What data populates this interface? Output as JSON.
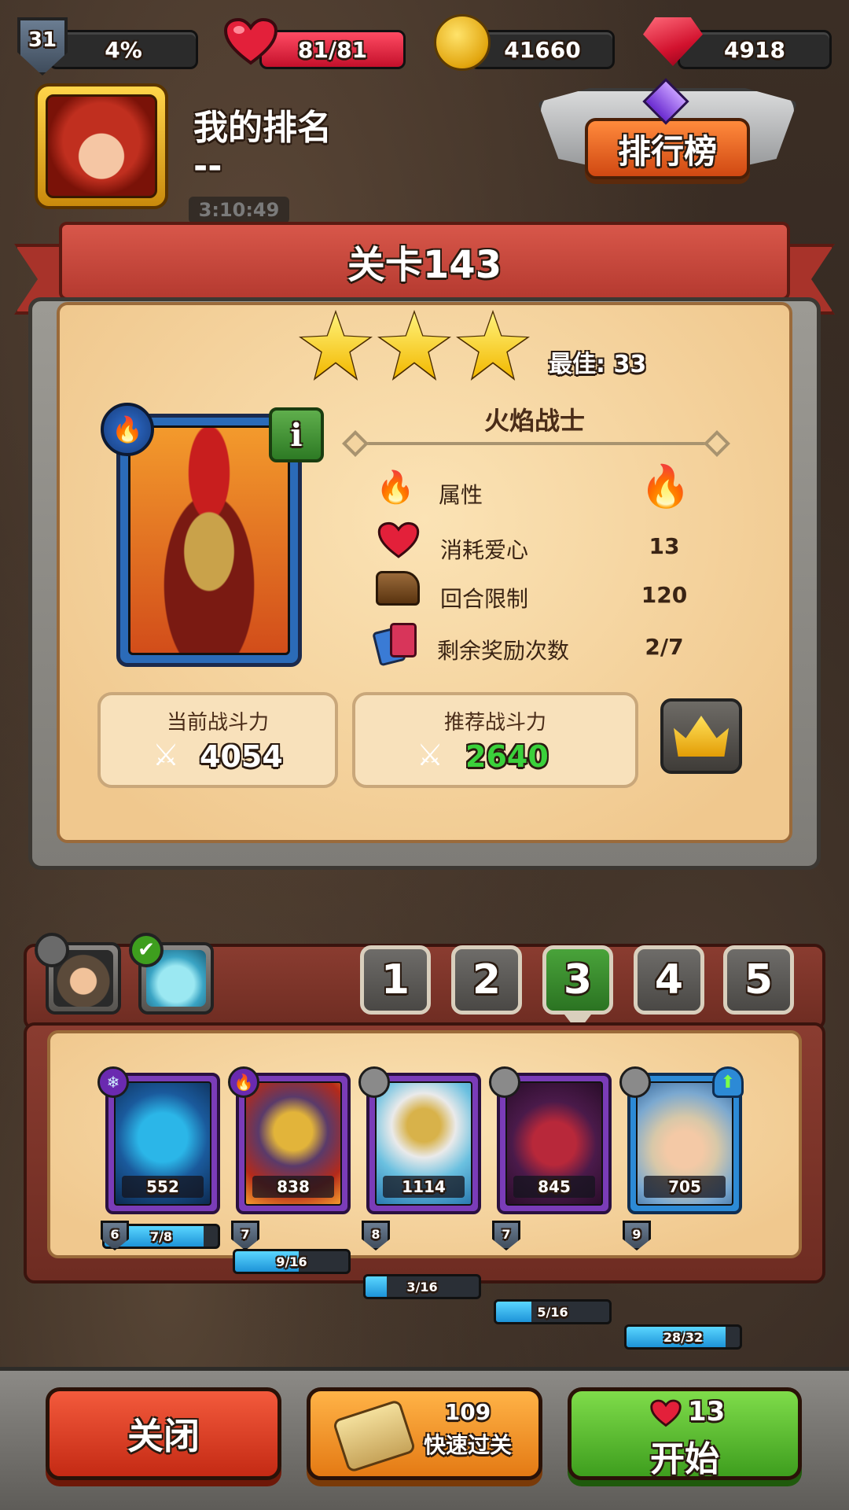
{
  "top_bar": {
    "level": "31",
    "xp_percent": "4%",
    "hp": "81/81",
    "hp_fraction": 1.0,
    "coins": "41660",
    "gems": "4918"
  },
  "profile": {
    "my_rank_label": "我的排名",
    "my_rank_value": "--",
    "timer": "3:10:49",
    "ranking_button": "排行榜"
  },
  "stage": {
    "title": "关卡143",
    "stars": 3,
    "best_label": "最佳: 33",
    "boss_name": "火焰战士",
    "info_label": "i",
    "stats": [
      {
        "icon": "element-icon",
        "label": "属性",
        "value": ""
      },
      {
        "icon": "heart-cost-icon",
        "label": "消耗爱心",
        "value": "13"
      },
      {
        "icon": "boot-icon",
        "label": "回合限制",
        "value": "120"
      },
      {
        "icon": "cards-icon",
        "label": "剩余奖励次数",
        "value": "2/7"
      }
    ],
    "current_power_label": "当前战斗力",
    "current_power_value": "4054",
    "recommended_power_label": "推荐战斗力",
    "recommended_power_value": "2640"
  },
  "team": {
    "tabs": [
      "1",
      "2",
      "3",
      "4",
      "5"
    ],
    "active_tab": "3",
    "heroes": [
      {
        "element": "ice",
        "power": "552",
        "level": "6",
        "progress": "7/8",
        "fill": 0.875,
        "rarity": "epic"
      },
      {
        "element": "fire",
        "power": "838",
        "level": "7",
        "progress": "9/16",
        "fill": 0.5625,
        "rarity": "epic"
      },
      {
        "element": "neutral",
        "power": "1114",
        "level": "8",
        "progress": "3/16",
        "fill": 0.1875,
        "rarity": "epic"
      },
      {
        "element": "neutral",
        "power": "845",
        "level": "7",
        "progress": "5/16",
        "fill": 0.3125,
        "rarity": "epic"
      },
      {
        "element": "neutral",
        "power": "705",
        "level": "9",
        "progress": "28/32",
        "fill": 0.875,
        "rarity": "rare"
      }
    ]
  },
  "bottom": {
    "close_label": "关闭",
    "quick_count": "109",
    "quick_label": "快速过关",
    "start_cost": "13",
    "start_label": "开始"
  },
  "colors": {
    "accent_green": "#3e9e1e",
    "accent_red": "#c42a14",
    "recommended_power": "#3bd13b"
  }
}
